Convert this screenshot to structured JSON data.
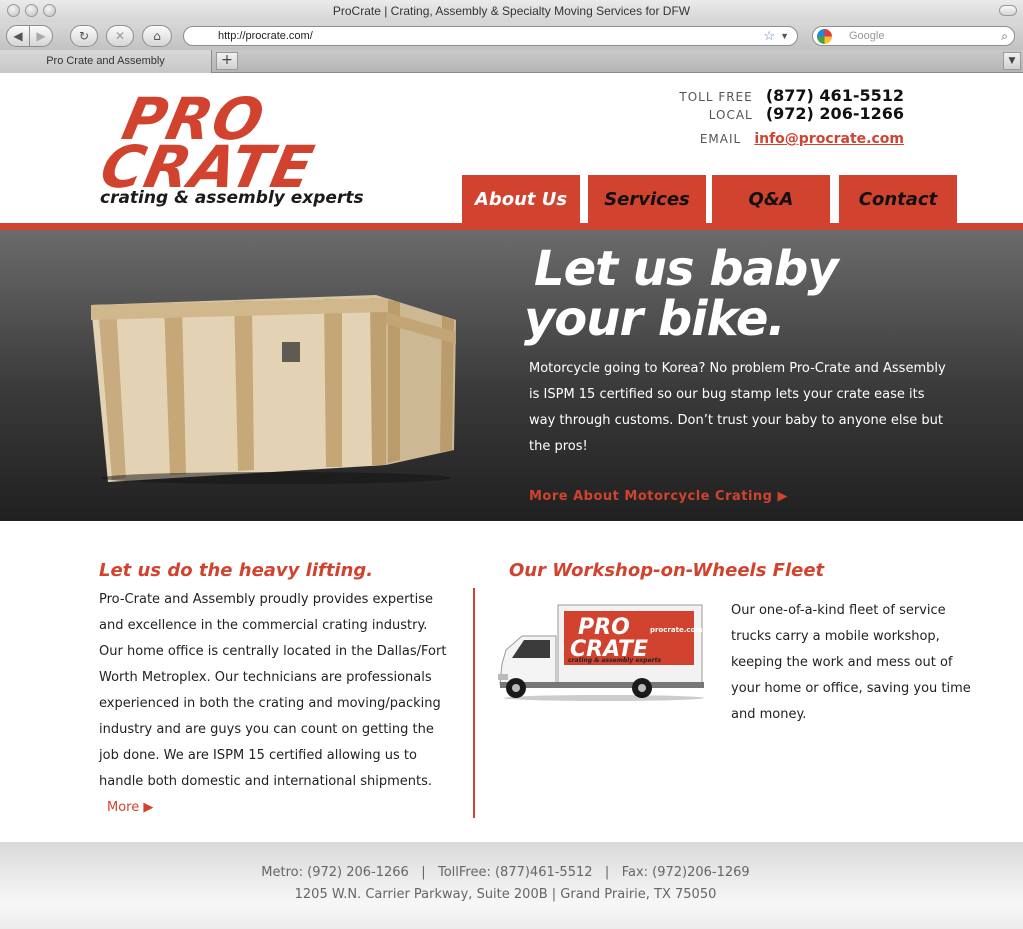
{
  "browser": {
    "window_title": "ProCrate | Crating, Assembly & Specialty Moving Services for DFW",
    "url": "http://procrate.com/",
    "search_placeholder": "Google",
    "tab_title": "Pro Crate and Assembly",
    "new_tab_label": "+",
    "buttons": {
      "back": "◀",
      "forward": "▶",
      "reload": "↻",
      "stop": "✕",
      "home": "⌂"
    },
    "icons": [
      "back-icon",
      "forward-icon",
      "reload-icon",
      "stop-icon",
      "home-icon",
      "bookmark-star-icon",
      "search-icon"
    ]
  },
  "header": {
    "logo_line1": "PRO",
    "logo_line2": "CRATE",
    "logo_tagline": "crating & assembly experts",
    "contact": {
      "toll_free_label": "TOLL FREE",
      "toll_free": "(877) 461-5512",
      "local_label": "LOCAL",
      "local": "(972) 206-1266",
      "email_label": "EMAIL",
      "email": "info@procrate.com"
    },
    "nav": [
      "About Us",
      "Services",
      "Q&A",
      "Contact"
    ],
    "active_nav": "About Us"
  },
  "hero": {
    "title_line1": "Let us baby",
    "title_line2": "your bike.",
    "body": "Motorcycle going to Korea?  No problem Pro-Crate and Assembly is ISPM 15 certified so our bug stamp lets your crate ease its way through customs. Don’t trust your baby to anyone else but the pros!",
    "link": "More About Motorcycle Crating ▶"
  },
  "left_column": {
    "title": "Let us do the heavy lifting.",
    "body": "Pro-Crate and Assembly proudly provides expertise and excellence in the commercial crating industry. Our home office is centrally located in the Dallas/Fort Worth Metroplex. Our technicians are professionals experienced in both the crating and moving/packing industry and are guys you can count on getting the job done. We are ISPM 15 certified allowing us to handle both domestic and international shipments.",
    "more": "More ▶"
  },
  "right_column": {
    "title": "Our Workshop-on-Wheels Fleet",
    "body": "Our one-of-a-kind fleet of service trucks carry a mobile workshop, keeping the work and mess out of your home or office, saving you time and money.",
    "truck_logo_line1": "PRO",
    "truck_logo_line2": "CRATE",
    "truck_site": "procrate.com",
    "truck_tagline": "crating & assembly experts"
  },
  "footer": {
    "line1": "Metro: (972) 206-1266   |   TollFree: (877)461-5512   |   Fax: (972)206-1269",
    "line2": "1205 W.N. Carrier Parkway, Suite 200B  |  Grand Prairie, TX 75050"
  },
  "colors": {
    "brand_red": "#d2432f",
    "hero_dark": "#2b2b2b",
    "text": "#222222"
  }
}
